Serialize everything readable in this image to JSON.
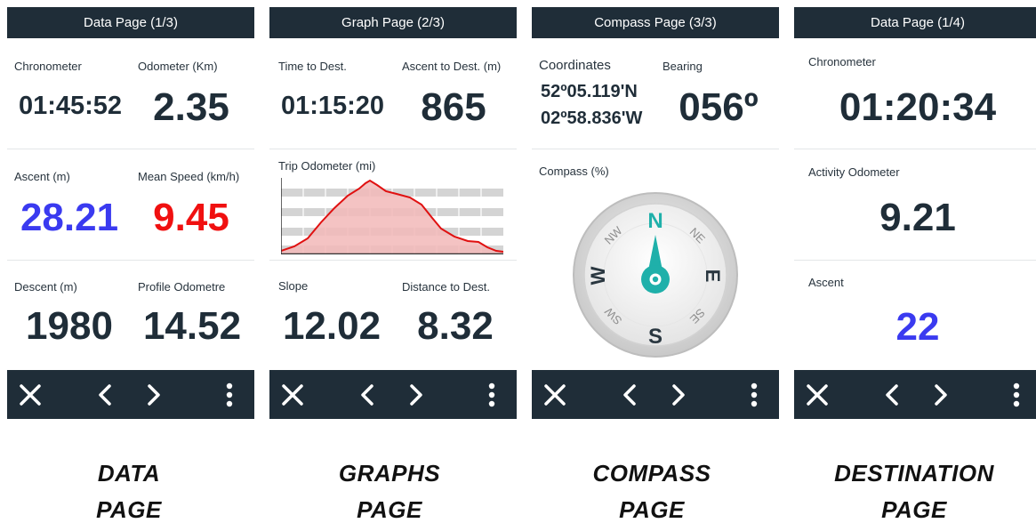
{
  "screens": [
    {
      "title": "Data Page (1/3)",
      "fields": [
        {
          "label": "Chronometer",
          "value": "01:45:52"
        },
        {
          "label": "Odometer (Km)",
          "value": "2.35"
        },
        {
          "label": "Ascent (m)",
          "value": "28.21"
        },
        {
          "label": "Mean Speed (km/h)",
          "value": "9.45"
        },
        {
          "label": "Descent (m)",
          "value": "1980"
        },
        {
          "label": "Profile Odometre",
          "value": "14.52"
        }
      ],
      "caption_line1": "DATA",
      "caption_line2": "PAGE"
    },
    {
      "title": "Graph Page (2/3)",
      "fields": [
        {
          "label": "Time to Dest.",
          "value": "01:15:20"
        },
        {
          "label": "Ascent to Dest. (m)",
          "value": "865"
        },
        {
          "label": "Slope",
          "value": "12.02"
        },
        {
          "label": "Distance to Dest.",
          "value": "8.32"
        }
      ],
      "graph_label": "Trip Odometer (mi)",
      "caption_line1": "GRAPHS",
      "caption_line2": "PAGE"
    },
    {
      "title": "Compass Page (3/3)",
      "coordinates_label": "Coordinates",
      "lat": "52º05.119'N",
      "lon": "02º58.836'W",
      "bearing_label": "Bearing",
      "bearing_value": "056º",
      "compass_label": "Compass (%)",
      "compass": {
        "n": "N",
        "s": "S",
        "e": "E",
        "w": "W",
        "ne": "NE",
        "nw": "NW",
        "se": "SE",
        "sw": "SW",
        "heading_deg": 56
      },
      "caption_line1": "COMPASS",
      "caption_line2": "PAGE"
    },
    {
      "title": "Data Page (1/4)",
      "fields": [
        {
          "label": "Chronometer",
          "value": "01:20:34"
        },
        {
          "label": "Activity Odometer",
          "value": "9.21"
        },
        {
          "label": "Ascent",
          "value": "22"
        }
      ],
      "caption_line1": "DESTINATION",
      "caption_line2": "PAGE"
    }
  ],
  "toolbar_icons": [
    "close-icon",
    "chevron-left-icon",
    "chevron-right-icon",
    "more-vertical-icon"
  ],
  "colors": {
    "dark": "#1f2d38",
    "blue": "#3a3af0",
    "red": "#f01010",
    "teal": "#1fb0aa",
    "graph_fill": "#f2b8b8",
    "graph_line": "#e01010"
  }
}
